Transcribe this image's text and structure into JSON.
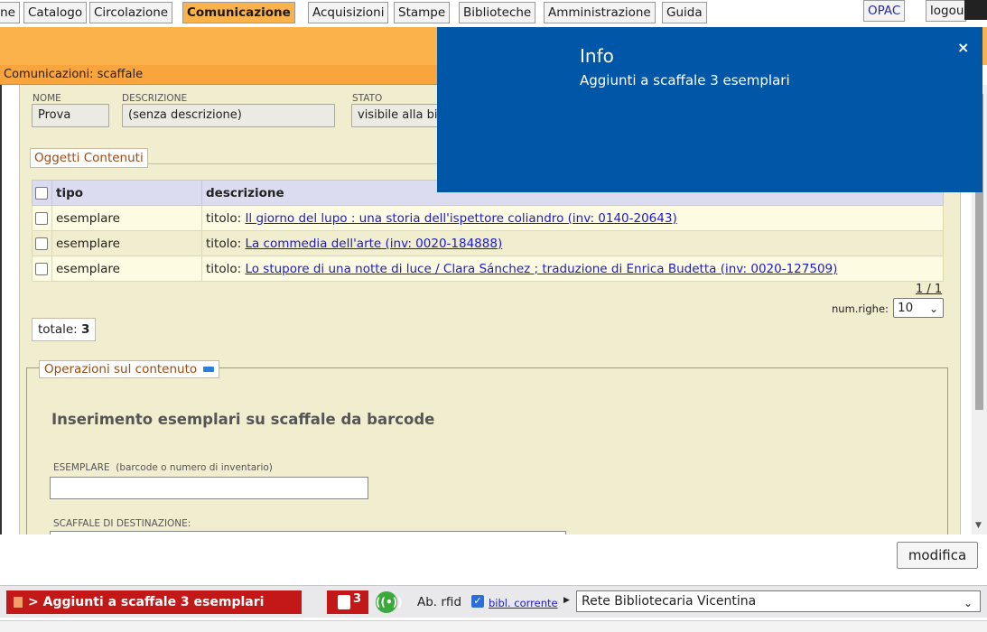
{
  "tabs": [
    {
      "label": "ne"
    },
    {
      "label": "Catalogo"
    },
    {
      "label": "Circolazione"
    },
    {
      "label": "Comunicazione"
    },
    {
      "label": "Acquisizioni"
    },
    {
      "label": "Stampe"
    },
    {
      "label": "Biblioteche"
    },
    {
      "label": "Amministrazione"
    },
    {
      "label": "Guida"
    }
  ],
  "top_right": {
    "opac_label": "OPAC",
    "logout_label": "logou"
  },
  "panel": {
    "title": "Comunicazioni: scaffale"
  },
  "form": {
    "nome_label": "NOME",
    "nome_value": "Prova",
    "descrizione_label": "DESCRIZIONE",
    "descrizione_value": "(senza descrizione)",
    "stato_label": "STATO",
    "stato_value": "visibile alla bib"
  },
  "oggetti": {
    "legend": "Oggetti Contenuti",
    "headers": {
      "tipo": "tipo",
      "descrizione": "descrizione"
    },
    "rows": [
      {
        "tipo": "esemplare",
        "prefix": "titolo:",
        "title": "Il giorno del lupo : una storia dell'ispettore coliandro (inv: 0140-20643)"
      },
      {
        "tipo": "esemplare",
        "prefix": "titolo:",
        "title": "La commedia dell'arte (inv: 0020-184888)"
      },
      {
        "tipo": "esemplare",
        "prefix": "titolo:",
        "title": "Lo stupore di una notte di luce / Clara Sánchez ; traduzione di Enrica Budetta (inv: 0020-127509)"
      }
    ],
    "pager": "1 / 1",
    "num_righe_label": "num.righe:",
    "num_righe_value": "10",
    "totale_label": "totale:",
    "totale_value": "3"
  },
  "operazioni": {
    "legend": "Operazioni sul contenuto",
    "title": "Inserimento esemplari su scaffale da barcode",
    "esemplare_label": "ESEMPLARE",
    "esemplare_hint": "(barcode o numero di inventario)",
    "esemplare_value": "",
    "scaffale_label": "SCAFFALE DI DESTINAZIONE:"
  },
  "actions": {
    "modifica_label": "modifica"
  },
  "status": {
    "notice_text": "> Aggiunti a scaffale 3 esemplari",
    "lock_count": "3",
    "rfid_label": "Ab. rfid",
    "rfid_checked": true,
    "bibl_corrente_label": "bibl. corrente",
    "rete_value": "Rete Bibliotecaria Vicentina"
  },
  "info_popup": {
    "title": "Info",
    "message": "Aggiunti a scaffale 3 esemplari",
    "close_symbol": "×"
  },
  "colors": {
    "accent_orange": "#fbb24a",
    "info_blue": "#0057a8",
    "alert_red": "#c21818"
  }
}
